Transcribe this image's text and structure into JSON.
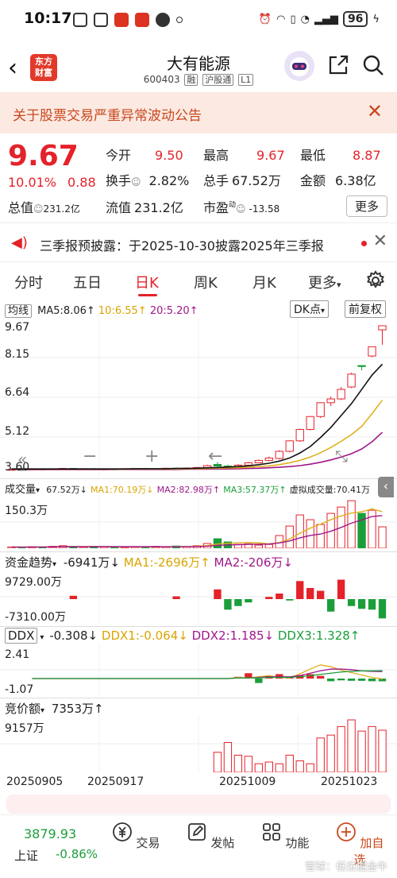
{
  "status": {
    "time": "10:17",
    "battery": "96"
  },
  "header": {
    "logo_text": "东方\n财富",
    "stock_name": "大有能源",
    "stock_code": "600403",
    "tag_rong": "融",
    "tag_hgt": "沪股通",
    "tag_l1": "L1"
  },
  "notice": {
    "text": "关于股票交易严重异常波动公告"
  },
  "quote": {
    "price": "9.67",
    "change_pct": "10.01%",
    "change_amt": "0.88",
    "open_label": "今开",
    "open": "9.50",
    "high_label": "最高",
    "high": "9.67",
    "low_label": "最低",
    "low": "8.87",
    "turnover_label": "换手",
    "turnover": "2.82%",
    "vol_label": "总手",
    "vol": "67.52万",
    "amount_label": "金额",
    "amount": "6.38亿",
    "mktcap_label": "总值",
    "mktcap": "231.2亿",
    "float_label": "流值",
    "float": "231.2亿",
    "pe_label": "市盈",
    "pe_sup": "动",
    "pe": "-13.58",
    "more": "更多"
  },
  "announcement": {
    "text": "三季报预披露：于2025-10-30披露2025年三季报"
  },
  "tabs": [
    "分时",
    "五日",
    "日K",
    "周K",
    "月K",
    "更多"
  ],
  "active_tab": 2,
  "kline": {
    "ma_label": "均线",
    "ma5": "MA5:8.06↑",
    "ma10": "10:6.55↑",
    "ma20": "20:5.20↑",
    "dk_label": "DK点",
    "fq_label": "前复权",
    "y_labels": [
      "9.67",
      "8.15",
      "6.64",
      "5.12",
      "3.60"
    ]
  },
  "volume": {
    "label": "成交量",
    "val": "67.52万↓",
    "ma1": "MA1:70.19万↓",
    "ma2": "MA2:82.98万↑",
    "ma3": "MA3:57.37万↑",
    "virtual": "虚拟成交量:70.41万",
    "y_label": "150.3万"
  },
  "fund": {
    "label": "资金趋势",
    "val": "-6941万↓",
    "ma1": "MA1:-2696万↑",
    "ma2": "MA2:-206万↓",
    "y_top": "9729.00万",
    "y_bottom": "-7310.00万"
  },
  "ddx": {
    "label": "DDX",
    "val": "-0.308↓",
    "ddx1": "DDX1:-0.064↓",
    "ddx2": "DDX2:1.185↓",
    "ddx3": "DDX3:1.328↑",
    "y_top": "2.41",
    "y_bottom": "-1.07"
  },
  "auction": {
    "label": "竞价额",
    "val": "7353万↑",
    "y_label": "9157万"
  },
  "dates": [
    "20250905",
    "20250917",
    "20251009",
    "20251023"
  ],
  "bottom": {
    "index_value": "3879.93",
    "index_name": "上证",
    "index_change": "-0.86%",
    "trade": "交易",
    "post": "发帖",
    "func": "功能",
    "watch": "加自选"
  },
  "watermark": "雪球：低位掘金牛",
  "chart_data": {
    "type": "candlestick",
    "ylim": [
      3.6,
      9.67
    ],
    "candles": [
      {
        "o": 3.62,
        "c": 3.64,
        "h": 3.66,
        "l": 3.6
      },
      {
        "o": 3.64,
        "c": 3.63,
        "h": 3.66,
        "l": 3.61
      },
      {
        "o": 3.63,
        "c": 3.65,
        "h": 3.67,
        "l": 3.61
      },
      {
        "o": 3.65,
        "c": 3.64,
        "h": 3.67,
        "l": 3.62
      },
      {
        "o": 3.64,
        "c": 3.66,
        "h": 3.68,
        "l": 3.62
      },
      {
        "o": 3.66,
        "c": 3.68,
        "h": 3.7,
        "l": 3.64
      },
      {
        "o": 3.68,
        "c": 3.66,
        "h": 3.7,
        "l": 3.64
      },
      {
        "o": 3.66,
        "c": 3.67,
        "h": 3.69,
        "l": 3.64
      },
      {
        "o": 3.67,
        "c": 3.65,
        "h": 3.69,
        "l": 3.63
      },
      {
        "o": 3.65,
        "c": 3.66,
        "h": 3.68,
        "l": 3.63
      },
      {
        "o": 3.66,
        "c": 3.65,
        "h": 3.68,
        "l": 3.63
      },
      {
        "o": 3.65,
        "c": 3.67,
        "h": 3.69,
        "l": 3.63
      },
      {
        "o": 3.67,
        "c": 3.68,
        "h": 3.7,
        "l": 3.65
      },
      {
        "o": 3.68,
        "c": 3.66,
        "h": 3.7,
        "l": 3.64
      },
      {
        "o": 3.66,
        "c": 3.67,
        "h": 3.69,
        "l": 3.64
      },
      {
        "o": 3.67,
        "c": 3.69,
        "h": 3.71,
        "l": 3.65
      },
      {
        "o": 3.69,
        "c": 3.68,
        "h": 3.72,
        "l": 3.66
      },
      {
        "o": 3.68,
        "c": 3.7,
        "h": 3.72,
        "l": 3.66
      },
      {
        "o": 3.7,
        "c": 3.72,
        "h": 3.74,
        "l": 3.68
      },
      {
        "o": 3.72,
        "c": 3.8,
        "h": 3.84,
        "l": 3.7
      },
      {
        "o": 3.85,
        "c": 3.78,
        "h": 3.95,
        "l": 3.74
      },
      {
        "o": 3.78,
        "c": 3.74,
        "h": 3.84,
        "l": 3.7
      },
      {
        "o": 3.74,
        "c": 3.82,
        "h": 3.86,
        "l": 3.72
      },
      {
        "o": 3.82,
        "c": 3.92,
        "h": 3.96,
        "l": 3.8
      },
      {
        "o": 3.92,
        "c": 4.02,
        "h": 4.06,
        "l": 3.9
      },
      {
        "o": 4.02,
        "c": 4.12,
        "h": 4.18,
        "l": 3.98
      },
      {
        "o": 4.1,
        "c": 4.4,
        "h": 4.45,
        "l": 4.06
      },
      {
        "o": 4.4,
        "c": 4.84,
        "h": 4.86,
        "l": 4.36
      },
      {
        "o": 4.84,
        "c": 5.32,
        "h": 5.35,
        "l": 4.8
      },
      {
        "o": 5.32,
        "c": 5.86,
        "h": 5.88,
        "l": 5.28
      },
      {
        "o": 5.86,
        "c": 6.44,
        "h": 6.46,
        "l": 5.8
      },
      {
        "o": 6.44,
        "c": 6.6,
        "h": 6.7,
        "l": 6.3
      },
      {
        "o": 6.6,
        "c": 7.0,
        "h": 7.1,
        "l": 6.55
      },
      {
        "o": 7.1,
        "c": 7.64,
        "h": 7.7,
        "l": 7.05
      },
      {
        "o": 8.0,
        "c": 7.96,
        "h": 8.0,
        "l": 7.8
      },
      {
        "o": 8.4,
        "c": 8.79,
        "h": 8.79,
        "l": 8.35
      },
      {
        "o": 9.5,
        "c": 9.67,
        "h": 9.67,
        "l": 8.87
      }
    ],
    "ma_black": [
      3.66,
      3.66,
      3.66,
      3.66,
      3.66,
      3.66,
      3.66,
      3.66,
      3.66,
      3.66,
      3.66,
      3.66,
      3.67,
      3.67,
      3.67,
      3.67,
      3.68,
      3.68,
      3.69,
      3.71,
      3.72,
      3.74,
      3.76,
      3.79,
      3.84,
      3.9,
      3.99,
      4.12,
      4.33,
      4.6,
      4.98,
      5.4,
      5.9,
      6.4,
      7.0,
      7.6,
      8.06
    ],
    "ma_yellow": [
      3.65,
      3.65,
      3.65,
      3.65,
      3.65,
      3.65,
      3.65,
      3.65,
      3.65,
      3.65,
      3.65,
      3.65,
      3.66,
      3.66,
      3.66,
      3.66,
      3.66,
      3.67,
      3.67,
      3.68,
      3.69,
      3.7,
      3.71,
      3.73,
      3.76,
      3.79,
      3.84,
      3.92,
      4.02,
      4.16,
      4.34,
      4.56,
      4.82,
      5.1,
      5.45,
      5.98,
      6.55
    ],
    "ma_purple": [
      3.63,
      3.63,
      3.63,
      3.63,
      3.63,
      3.63,
      3.63,
      3.63,
      3.63,
      3.63,
      3.64,
      3.64,
      3.64,
      3.64,
      3.64,
      3.64,
      3.64,
      3.65,
      3.65,
      3.65,
      3.66,
      3.66,
      3.67,
      3.68,
      3.69,
      3.71,
      3.73,
      3.76,
      3.8,
      3.86,
      3.94,
      4.04,
      4.16,
      4.3,
      4.5,
      4.8,
      5.2
    ],
    "volume": [
      4,
      3,
      5,
      4,
      6,
      8,
      5,
      4,
      6,
      5,
      4,
      3,
      5,
      4,
      6,
      5,
      7,
      6,
      8,
      15,
      30,
      20,
      12,
      14,
      10,
      12,
      40,
      70,
      105,
      90,
      75,
      110,
      130,
      150,
      110,
      120,
      67.52
    ],
    "volume_up": [
      true,
      false,
      true,
      false,
      true,
      true,
      false,
      true,
      false,
      true,
      false,
      true,
      true,
      false,
      true,
      true,
      false,
      true,
      true,
      true,
      false,
      false,
      true,
      true,
      true,
      true,
      true,
      true,
      true,
      true,
      true,
      true,
      true,
      true,
      false,
      true,
      true
    ],
    "fund": [
      0,
      0,
      0,
      0,
      0,
      0,
      1200,
      0,
      0,
      0,
      0,
      0,
      0,
      0,
      0,
      0,
      1000,
      0,
      0,
      0,
      3500,
      -3800,
      -2500,
      -1200,
      0,
      800,
      2000,
      -500,
      6500,
      4000,
      3000,
      -4500,
      7000,
      -2500,
      -3500,
      -3800,
      -6941
    ],
    "ddx_bars": [
      0,
      0,
      0,
      0,
      0,
      0,
      0,
      0,
      0,
      0,
      0,
      0,
      0,
      0,
      0,
      0,
      0,
      0,
      0.2,
      0.6,
      -0.5,
      0.3,
      0.5,
      0.2,
      0.4,
      0.5,
      0.3,
      -0.3,
      -0.2,
      -0.25,
      -0.25,
      -0.3,
      -0.308
    ],
    "auction": [
      0,
      0,
      0,
      0,
      0,
      0,
      0,
      0,
      0,
      0,
      0,
      0,
      0,
      0,
      0,
      0,
      0,
      0,
      0,
      0,
      3500,
      5200,
      3000,
      2800,
      1500,
      1800,
      1500,
      3000,
      2000,
      1500,
      6000,
      6500,
      8000,
      9157,
      7200,
      8000,
      7353
    ]
  }
}
